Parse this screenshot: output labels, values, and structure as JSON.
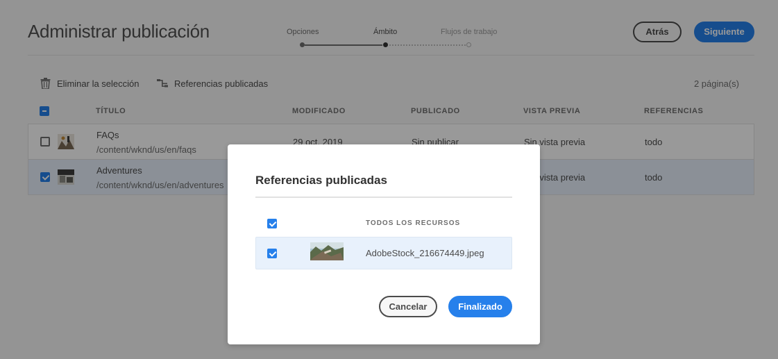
{
  "header": {
    "title": "Administrar publicación",
    "steps": [
      {
        "label": "Opciones",
        "state": "done"
      },
      {
        "label": "Ámbito",
        "state": "current"
      },
      {
        "label": "Flujos de trabajo",
        "state": "future"
      }
    ],
    "back_label": "Atrás",
    "next_label": "Siguiente"
  },
  "toolbar": {
    "delete_label": "Eliminar la selección",
    "references_label": "Referencias publicadas",
    "page_count": "2 página(s)"
  },
  "table": {
    "columns": [
      "TÍTULO",
      "MODIFICADO",
      "PUBLICADO",
      "VISTA PREVIA",
      "REFERENCIAS"
    ],
    "rows": [
      {
        "title": "FAQs",
        "path": "/content/wknd/us/en/faqs",
        "modified": "29 oct. 2019",
        "published": "Sin publicar",
        "preview": "Sin vista previa",
        "references": "todo",
        "selected": false
      },
      {
        "title": "Adventures",
        "path": "/content/wknd/us/en/adventures",
        "modified": "",
        "published": "",
        "preview": "Sin vista previa",
        "references": "todo",
        "selected": true
      }
    ]
  },
  "dialog": {
    "title": "Referencias publicadas",
    "header_label": "TODOS LOS RECURSOS",
    "items": [
      {
        "filename": "AdobeStock_216674449.jpeg",
        "selected": true
      }
    ],
    "cancel_label": "Cancelar",
    "done_label": "Finalizado"
  },
  "colors": {
    "accent": "#2680eb",
    "overlay": "rgba(0,0,0,0.40)",
    "selected_row": "#e8f1fc"
  },
  "icons": {
    "delete": "trash-icon",
    "references": "references-icon"
  }
}
